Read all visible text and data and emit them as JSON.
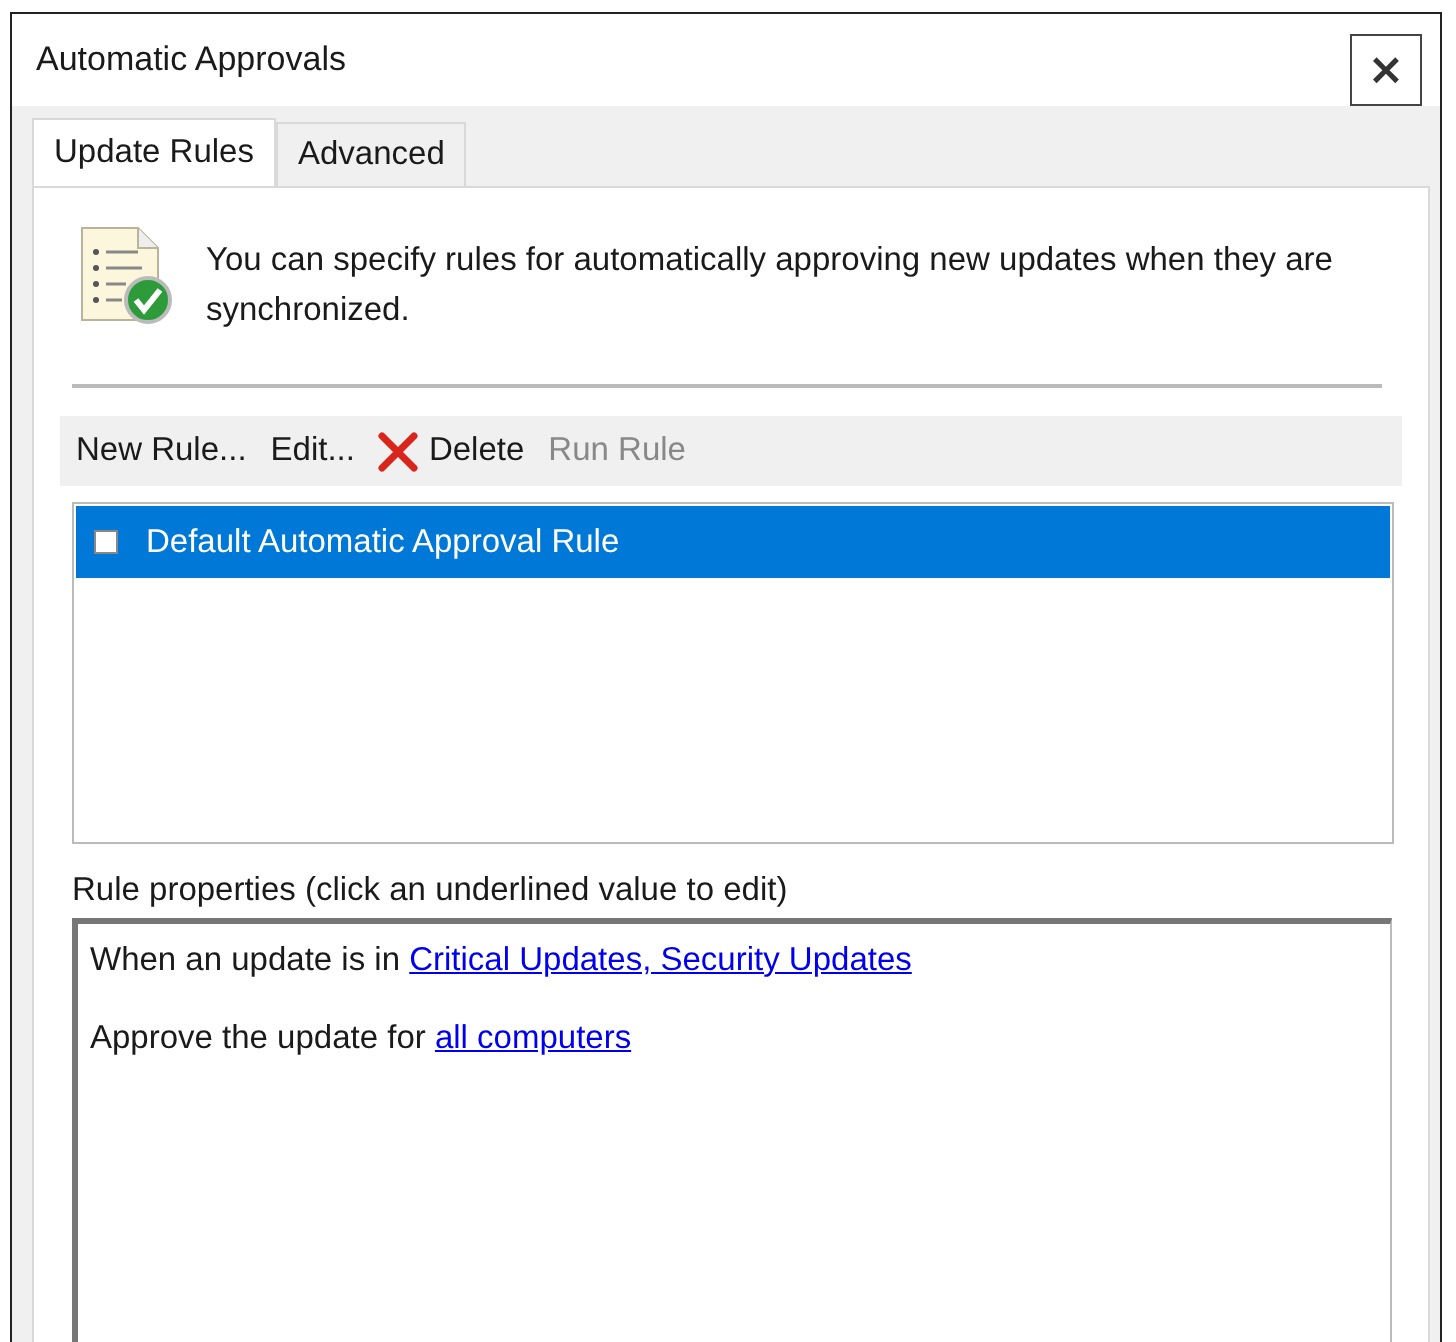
{
  "window": {
    "title": "Automatic Approvals",
    "close": "×"
  },
  "tabs": [
    {
      "label": "Update Rules",
      "selected": true
    },
    {
      "label": "Advanced",
      "selected": false
    }
  ],
  "intro": "You can specify rules for automatically approving new updates when they are synchronized.",
  "toolbar": [
    {
      "label": "New Rule...",
      "kind": "text",
      "disabled": false
    },
    {
      "label": "Edit...",
      "kind": "text",
      "disabled": false
    },
    {
      "label": "Delete",
      "kind": "delete",
      "disabled": false
    },
    {
      "label": "Run Rule",
      "kind": "text",
      "disabled": true
    }
  ],
  "rules": [
    {
      "name": "Default Automatic Approval Rule",
      "checked": false,
      "selected": true
    }
  ],
  "properties_label": "Rule properties (click an underlined value to edit)",
  "properties": [
    {
      "text": "When an update is in ",
      "link": "Critical Updates, Security Updates"
    },
    {
      "text": "Approve the update for ",
      "link": "all computers"
    }
  ]
}
